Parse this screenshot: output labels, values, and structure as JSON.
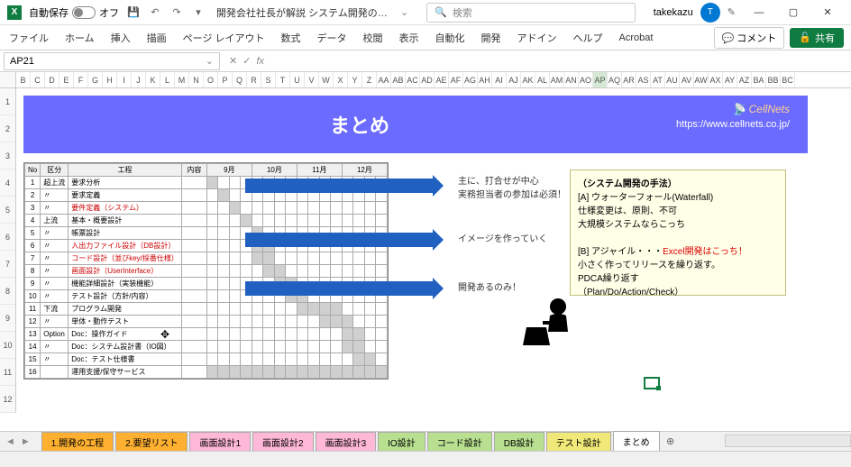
{
  "titlebar": {
    "autosave_label": "自動保存",
    "autosave_state": "オフ",
    "doc_title": "開発会社社長が解説 システム開発の工程…",
    "search_placeholder": "検索",
    "username": "takekazu",
    "avatar_initial": "T"
  },
  "ribbon": {
    "tabs": [
      "ファイル",
      "ホーム",
      "挿入",
      "描画",
      "ページ レイアウト",
      "数式",
      "データ",
      "校閲",
      "表示",
      "自動化",
      "開発",
      "アドイン",
      "ヘルプ",
      "Acrobat"
    ],
    "comment_btn": "コメント",
    "share_btn": "共有"
  },
  "formula": {
    "namebox": "AP21",
    "fx": "fx"
  },
  "columns": [
    "B",
    "C",
    "D",
    "E",
    "F",
    "G",
    "H",
    "I",
    "J",
    "K",
    "L",
    "M",
    "N",
    "O",
    "P",
    "Q",
    "R",
    "S",
    "T",
    "U",
    "V",
    "W",
    "X",
    "Y",
    "Z",
    "AA",
    "AB",
    "AC",
    "AD",
    "AE",
    "AF",
    "AG",
    "AH",
    "AI",
    "AJ",
    "AK",
    "AL",
    "AM",
    "AN",
    "AO",
    "AP",
    "AQ",
    "AR",
    "AS",
    "AT",
    "AU",
    "AV",
    "AW",
    "AX",
    "AY",
    "AZ",
    "BA",
    "BB",
    "BC"
  ],
  "selected_col": "AP",
  "rows": [
    "1",
    "2",
    "3",
    "4",
    "5",
    "6",
    "7",
    "8",
    "9",
    "10",
    "11",
    "12"
  ],
  "banner": {
    "title": "まとめ",
    "logo": "CellNets",
    "url": "https://www.cellnets.co.jp/"
  },
  "gantt": {
    "headers": [
      "No",
      "区分",
      "工程",
      "内容",
      "9月",
      "10月",
      "11月",
      "12月"
    ],
    "rows": [
      {
        "no": "1",
        "cat": "超上流",
        "task": "要求分析"
      },
      {
        "no": "2",
        "cat": "〃",
        "task": "要求定義"
      },
      {
        "no": "3",
        "cat": "〃",
        "task": "要件定義（システム）",
        "red": true
      },
      {
        "no": "4",
        "cat": "上流",
        "task": "基本・概要設計"
      },
      {
        "no": "5",
        "cat": "〃",
        "task": "帳票設計"
      },
      {
        "no": "6",
        "cat": "〃",
        "task": "入出力ファイル設計（DB設計）",
        "red": true
      },
      {
        "no": "7",
        "cat": "〃",
        "task": "コード設計（並びkey/採番仕様）",
        "red": true
      },
      {
        "no": "8",
        "cat": "〃",
        "task": "画面設計（UserInterface）",
        "red": true
      },
      {
        "no": "9",
        "cat": "〃",
        "task": "機能詳細設計（実装機能）"
      },
      {
        "no": "10",
        "cat": "〃",
        "task": "テスト設計（方針/内容）"
      },
      {
        "no": "11",
        "cat": "下流",
        "task": "プログラム開発"
      },
      {
        "no": "12",
        "cat": "〃",
        "task": "単体・動作テスト"
      },
      {
        "no": "13",
        "cat": "Option",
        "task": "Doc：操作ガイド"
      },
      {
        "no": "14",
        "cat": "〃",
        "task": "Doc：システム設計書（IO図）"
      },
      {
        "no": "15",
        "cat": "〃",
        "task": "Doc：テスト仕様書"
      },
      {
        "no": "16",
        "cat": "",
        "task": "運用支援/保守サービス"
      }
    ]
  },
  "annotations": {
    "a1": "主に、打合せが中心\n実務担当者の参加は必須！",
    "a2": "イメージを作っていく",
    "a3": "開発あるのみ！"
  },
  "note": {
    "title": "（システム開発の手法）",
    "a_label": "[A] ウォーターフォール(Waterfall)",
    "a_line1": "仕様変更は、原則、不可",
    "a_line2": "大規模システムならこっち",
    "b_label": "[B] アジャイル・・・Excel開発はこっち！",
    "b_line1": "小さく作ってリリースを繰り返す。",
    "b_line2": "PDCA繰り返す",
    "b_line3": "（Plan/Do/Action/Check）"
  },
  "sheet_tabs": [
    {
      "label": "1.開発の工程",
      "cls": "orange"
    },
    {
      "label": "2.要望リスト",
      "cls": "orange"
    },
    {
      "label": "画面設計1",
      "cls": "pink"
    },
    {
      "label": "画面設計2",
      "cls": "pink"
    },
    {
      "label": "画面設計3",
      "cls": "pink"
    },
    {
      "label": "IO設計",
      "cls": "green"
    },
    {
      "label": "コード設計",
      "cls": "green"
    },
    {
      "label": "DB設計",
      "cls": "green"
    },
    {
      "label": "テスト設計",
      "cls": "yellow"
    },
    {
      "label": "まとめ",
      "cls": "active"
    }
  ],
  "新tab": "+"
}
